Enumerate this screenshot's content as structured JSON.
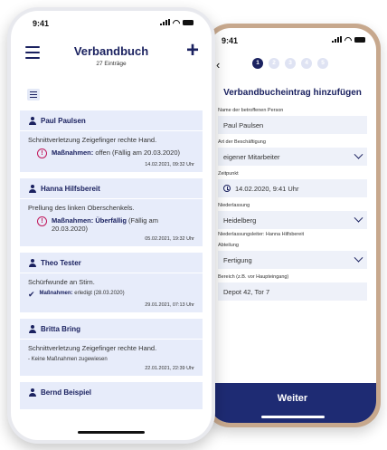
{
  "status_time": "9:41",
  "left": {
    "title": "Verbandbuch",
    "subtitle": "27 Einträge",
    "entries": [
      {
        "name": "Paul Paulsen",
        "description": "Schnittverletzung Zeigefinger rechte Hand.",
        "measure_label": "Maßnahmen:",
        "measure_text": " offen (Fällig am 20.03.2020)",
        "date": "14.02.2021, 09:32 Uhr"
      },
      {
        "name": "Hanna Hilfsbereit",
        "description": "Prellung des linken Oberschenkels.",
        "measure_label": "Maßnahmen: Überfällig",
        "measure_text": " (Fällig am 20.03.2020)",
        "date": "05.02.2021, 19:32 Uhr"
      },
      {
        "name": "Theo Tester",
        "description": "Schürfwunde an Stirn.",
        "measure_label": "Maßnahmen:",
        "measure_text": " erledigt (28.03.2020)",
        "date": "29.01.2021, 07:13 Uhr"
      },
      {
        "name": "Britta Bring",
        "description": "Schnittverletzung Zeigefinger rechte Hand.",
        "measure_text": "- Keine Maßnahmen zugewiesen",
        "date": "22.01.2021, 22:39 Uhr"
      },
      {
        "name": "Bernd Beispiel"
      }
    ]
  },
  "right": {
    "steps": [
      "1",
      "2",
      "3",
      "4",
      "5"
    ],
    "title": "Verbandbucheintrag hinzufügen",
    "fields": {
      "person_label": "Name der betroffenen Person",
      "person_value": "Paul Paulsen",
      "employment_label": "Art der Beschäftigung",
      "employment_value": "eigener Mitarbeiter",
      "time_label": "Zeitpunkt",
      "time_value": "14.02.2020, 9:41 Uhr",
      "branch_label": "Niederlassung",
      "branch_value": "Heidelberg",
      "branch_hint": "Niederlassungsleiter: Hanna Hilfsbereit",
      "dept_label": "Abteilung",
      "dept_value": "Fertigung",
      "area_label": "Bereich (z.B. vor Haupteingang)",
      "area_value": "Depot 42, Tor 7"
    },
    "button": "Weiter"
  },
  "colors": {
    "navy": "#1b2260",
    "card_bg": "#e7ecfa",
    "warning": "#c2185b",
    "button": "#1e2b73"
  }
}
